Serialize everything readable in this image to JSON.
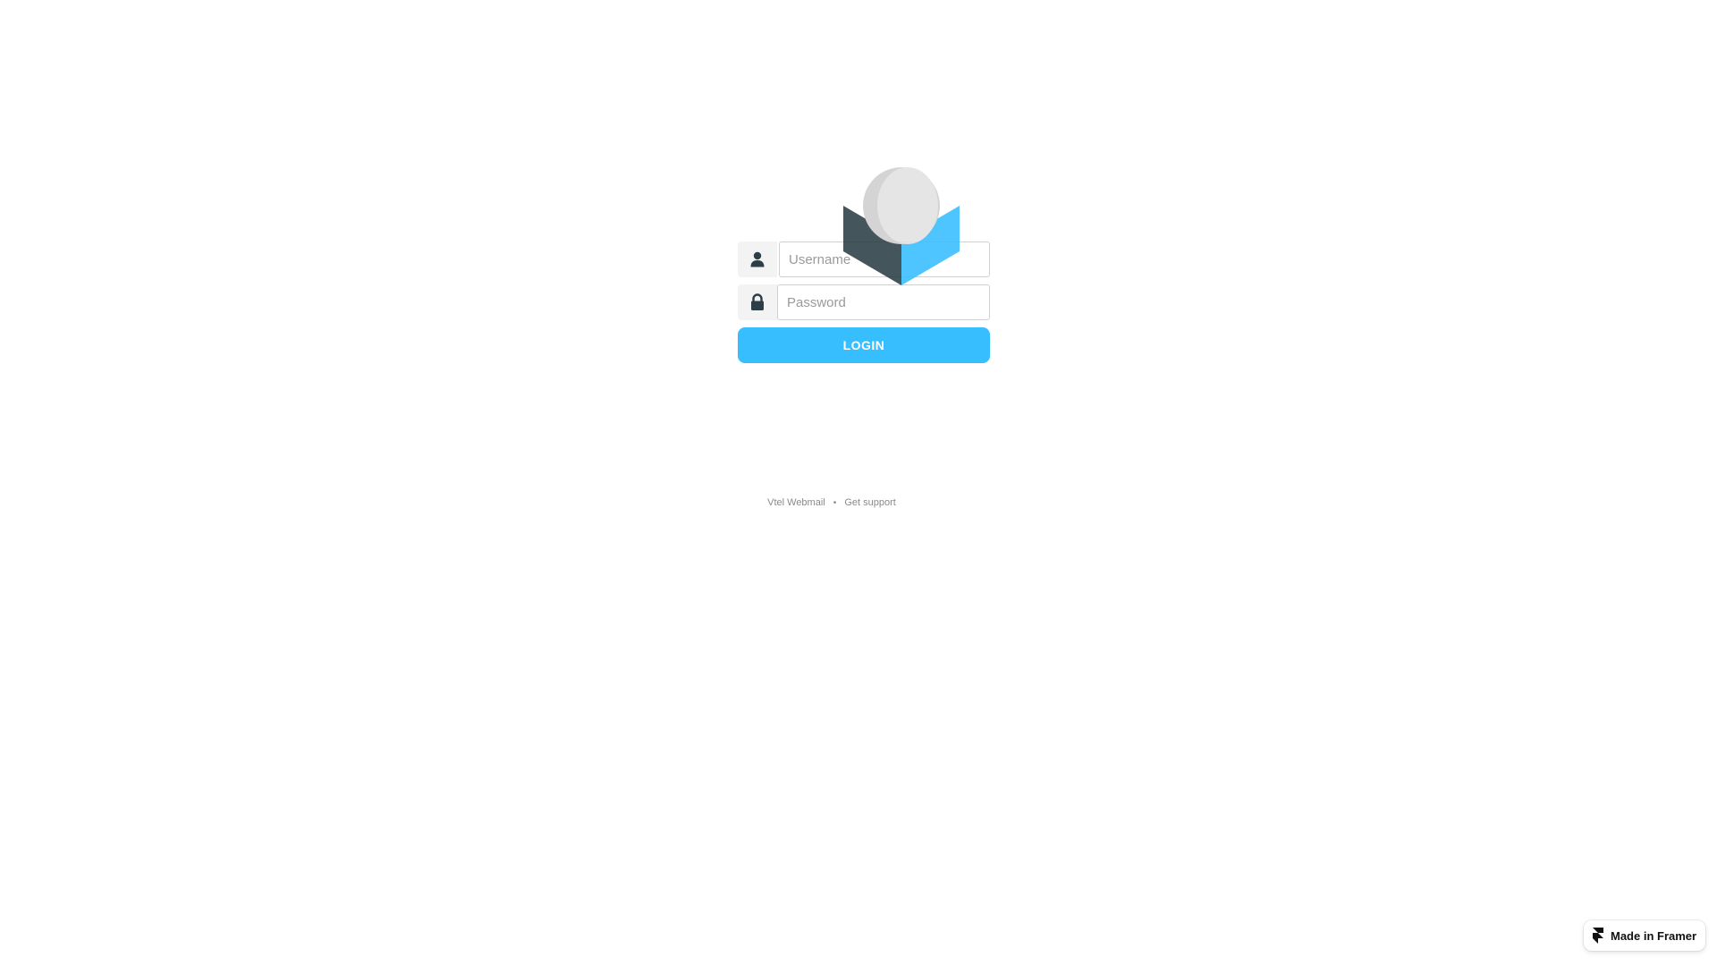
{
  "logo": {
    "name": "roundcube-logo",
    "colors": {
      "dark": "#2c3e46",
      "blue": "#37beff",
      "ball": "#dddddd"
    }
  },
  "login_form": {
    "username": {
      "value": "",
      "placeholder": "Username",
      "icon": "user-icon"
    },
    "password": {
      "value": "",
      "placeholder": "Password",
      "icon": "lock-icon"
    },
    "login_label": "LOGIN"
  },
  "footer": {
    "links": [
      "Vtel Webmail",
      "Get support"
    ]
  },
  "badge": {
    "label": "Made in Framer",
    "icon": "framer-icon"
  },
  "colors": {
    "accent": "#37beff",
    "addon_bg": "#f3f3f3"
  }
}
